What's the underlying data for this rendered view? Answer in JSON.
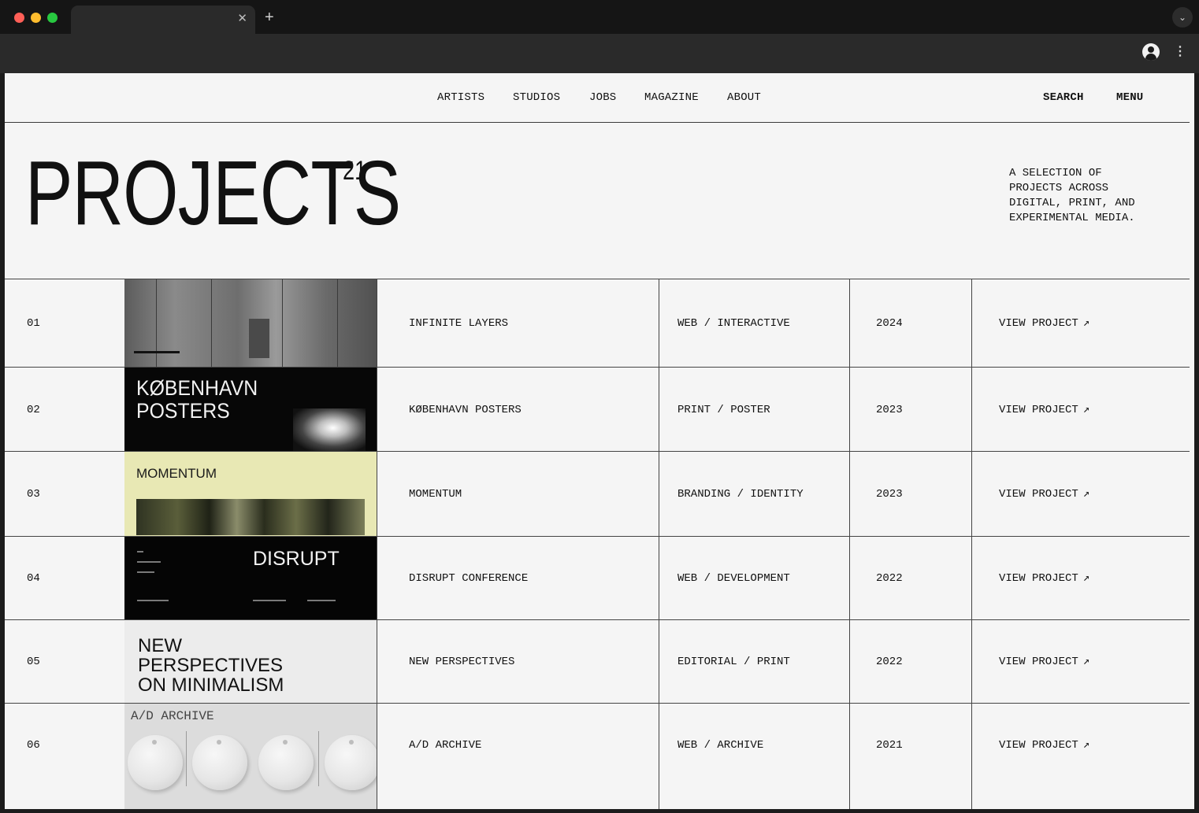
{
  "browser": {
    "window_controls": {
      "close_color": "#ff5f57",
      "minimize_color": "#febc2e",
      "zoom_color": "#28c840"
    },
    "tab": {
      "close_glyph": "✕"
    },
    "new_tab_glyph": "+",
    "tab_menu_glyph": "⌄",
    "menu_glyph": "⋮"
  },
  "nav": {
    "links": [
      "ARTISTS",
      "STUDIOS",
      "JOBS",
      "MAGAZINE",
      "ABOUT"
    ],
    "search_label": "SEARCH",
    "menu_label": "MENU"
  },
  "hero": {
    "title": "PROJECTS",
    "count": "21",
    "description": "A SELECTION OF PROJECTS ACROSS DIGITAL, PRINT, AND EXPERIMENTAL MEDIA."
  },
  "projects": [
    {
      "number": "01",
      "name": "INFINITE LAYERS",
      "category": "WEB / INTERACTIVE",
      "year": "2024",
      "link": "VIEW PROJECT",
      "thumbnail": {
        "type": "photo-gallery-interior"
      }
    },
    {
      "number": "02",
      "name": "KØBENHAVN POSTERS",
      "category": "PRINT / POSTER",
      "year": "2023",
      "link": "VIEW PROJECT",
      "thumbnail": {
        "type": "poster",
        "line1": "KØBENHAVN",
        "line2": "POSTERS"
      }
    },
    {
      "number": "03",
      "name": "MOMENTUM",
      "category": "BRANDING / IDENTITY",
      "year": "2023",
      "link": "VIEW PROJECT",
      "thumbnail": {
        "type": "brand",
        "text": "MOMENTUM"
      }
    },
    {
      "number": "04",
      "name": "DISRUPT CONFERENCE",
      "category": "WEB / DEVELOPMENT",
      "year": "2022",
      "link": "VIEW PROJECT",
      "thumbnail": {
        "type": "web",
        "text": "DISRUPT"
      }
    },
    {
      "number": "05",
      "name": "NEW PERSPECTIVES",
      "category": "EDITORIAL / PRINT",
      "year": "2022",
      "link": "VIEW PROJECT",
      "thumbnail": {
        "type": "editorial",
        "line1": "NEW",
        "line2": "PERSPECTIVES",
        "line3": "ON MINIMALISM"
      }
    },
    {
      "number": "06",
      "name": "A/D ARCHIVE",
      "category": "WEB / ARCHIVE",
      "year": "2021",
      "link": "VIEW PROJECT",
      "thumbnail": {
        "type": "archive",
        "text": "A/D ARCHIVE"
      }
    }
  ],
  "link_icon": "arrow-up-right-icon",
  "link_glyph": "↗",
  "colors": {
    "page_bg": "#f5f5f5",
    "text": "#111111",
    "rule": "#444444"
  }
}
